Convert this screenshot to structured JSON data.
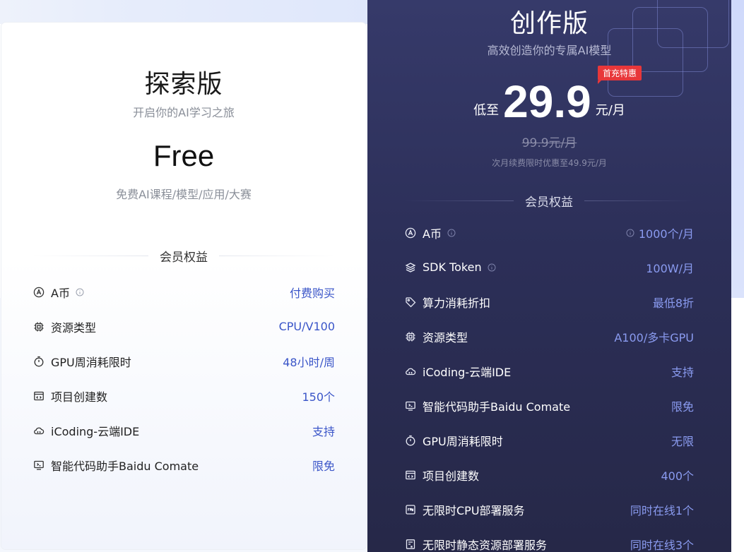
{
  "free": {
    "title": "探索版",
    "subtitle": "开启你的AI学习之旅",
    "price": "Free",
    "description": "免费AI课程/模型/应用/大赛",
    "section_label": "会员权益",
    "benefits": [
      {
        "name": "A币",
        "value": "付费购买",
        "icon": "a-coin-icon",
        "info": true
      },
      {
        "name": "资源类型",
        "value": "CPU/V100",
        "icon": "chip-icon"
      },
      {
        "name": "GPU周消耗限时",
        "value": "48小时/周",
        "icon": "timer-icon"
      },
      {
        "name": "项目创建数",
        "value": "150个",
        "icon": "project-window-icon"
      },
      {
        "name": "iCoding-云端IDE",
        "value": "支持",
        "icon": "cloud-code-icon"
      },
      {
        "name": "智能代码助手Baidu Comate",
        "value": "限免",
        "icon": "monitor-code-icon"
      }
    ]
  },
  "pro": {
    "title": "创作版",
    "subtitle": "高效创造你的专属AI模型",
    "price_prefix": "低至",
    "price": "29.9",
    "price_unit": "元/月",
    "promo_tag": "首充特惠",
    "original_price": "99.9元/月",
    "renew_note": "次月续费限时优惠至49.9元/月",
    "section_label": "会员权益",
    "benefits": [
      {
        "name": "A币",
        "value": "1000个/月",
        "icon": "a-coin-icon",
        "info": true,
        "value_info": true
      },
      {
        "name": "SDK Token",
        "value": "100W/月",
        "icon": "layers-icon",
        "info": true
      },
      {
        "name": "算力消耗折扣",
        "value": "最低8折",
        "icon": "tag-icon"
      },
      {
        "name": "资源类型",
        "value": "A100/多卡GPU",
        "icon": "chip-icon"
      },
      {
        "name": "iCoding-云端IDE",
        "value": "支持",
        "icon": "cloud-code-icon"
      },
      {
        "name": "智能代码助手Baidu Comate",
        "value": "限免",
        "icon": "monitor-code-icon"
      },
      {
        "name": "GPU周消耗限时",
        "value": "无限",
        "icon": "timer-icon"
      },
      {
        "name": "项目创建数",
        "value": "400个",
        "icon": "project-window-icon"
      },
      {
        "name": "无限时CPU部署服务",
        "value": "同时在线1个",
        "icon": "cpu-badge-icon"
      },
      {
        "name": "无限时静态资源部署服务",
        "value": "同时在线3个",
        "icon": "static-file-icon"
      }
    ]
  },
  "colors": {
    "free_value": "#3a55c8",
    "pro_value": "#8a9bf0",
    "pro_bg": "#2c2f58",
    "promo": "#e8373a"
  }
}
